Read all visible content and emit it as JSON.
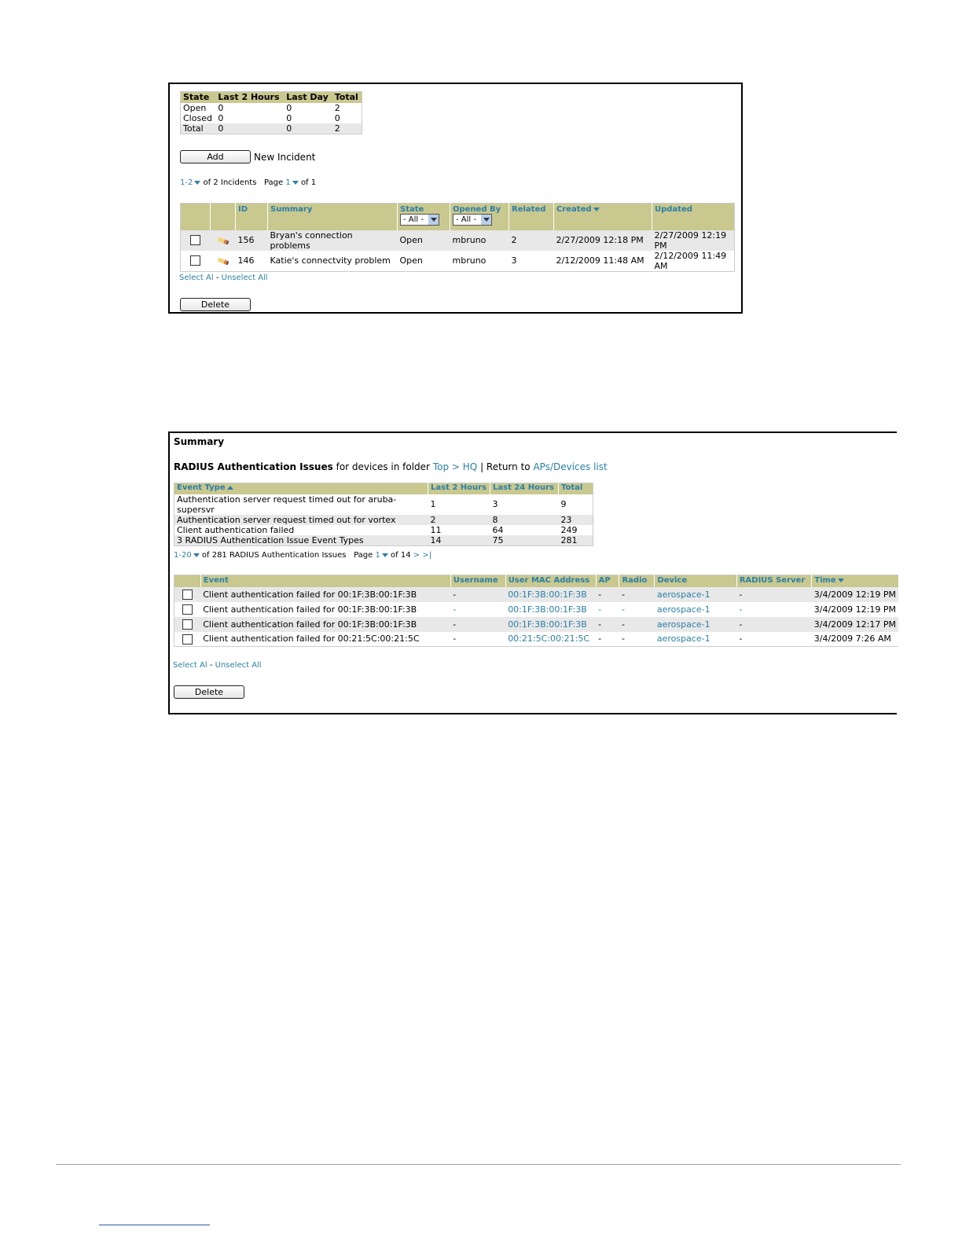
{
  "incidents": {
    "stats": {
      "headers": [
        "State",
        "Last 2 Hours",
        "Last Day",
        "Total"
      ],
      "rows": [
        [
          "Open",
          "0",
          "0",
          "2"
        ],
        [
          "Closed",
          "0",
          "0",
          "0"
        ],
        [
          "Total",
          "0",
          "0",
          "2"
        ]
      ]
    },
    "add_button": "Add",
    "add_label": "New Incident",
    "pager": {
      "range": "1-2",
      "of_text": "of 2 Incidents",
      "page_label": "Page",
      "page": "1",
      "page_of": "of 1"
    },
    "table_headers": {
      "id": "ID",
      "summary": "Summary",
      "state": "State",
      "opened_by": "Opened By",
      "related": "Related",
      "created": "Created",
      "updated": "Updated"
    },
    "state_filter": "- All -",
    "opened_by_filter": "- All -",
    "rows": [
      {
        "id": "156",
        "summary": "Bryan's connection problems",
        "state": "Open",
        "opened_by": "mbruno",
        "related": "2",
        "created": "2/27/2009 12:18 PM",
        "updated": "2/27/2009 12:19 PM"
      },
      {
        "id": "146",
        "summary": "Katie's connectvity problem",
        "state": "Open",
        "opened_by": "mbruno",
        "related": "3",
        "created": "2/12/2009 11:48 AM",
        "updated": "2/12/2009 11:49 AM"
      }
    ],
    "select_all": "Select Al",
    "separator": "-",
    "unselect_all": "Unselect All",
    "delete_button": "Delete"
  },
  "radius": {
    "summary_title": "Summary",
    "heading_bold": "RADIUS Authentication Issues",
    "heading_text": "for devices in folder",
    "folder_top": "Top",
    "folder_sep": ">",
    "folder_hq": "HQ",
    "return_text": "| Return to",
    "return_link": "APs/Devices list",
    "stats": {
      "headers": [
        "Event Type",
        "Last 2 Hours",
        "Last 24 Hours",
        "Total"
      ],
      "rows": [
        [
          "Authentication server request timed out for aruba-supersvr",
          "1",
          "3",
          "9"
        ],
        [
          "Authentication server request timed out for vortex",
          "2",
          "8",
          "23"
        ],
        [
          "Client authentication failed",
          "11",
          "64",
          "249"
        ],
        [
          "3 RADIUS Authentication Issue Event Types",
          "14",
          "75",
          "281"
        ]
      ]
    },
    "pager": {
      "range": "1-20",
      "of_text": "of 281 RADIUS Authentication Issues",
      "page_label": "Page",
      "page": "1",
      "page_of": "of 14",
      "next": ">",
      "last": ">|"
    },
    "table_headers": {
      "event": "Event",
      "username": "Username",
      "mac": "User MAC Address",
      "ap": "AP",
      "radio": "Radio",
      "device": "Device",
      "radius_server": "RADIUS Server",
      "time": "Time"
    },
    "rows": [
      {
        "event": "Client authentication failed for 00:1F:3B:00:1F:3B",
        "username": "-",
        "mac": "00:1F:3B:00:1F:3B",
        "ap": "-",
        "radio": "-",
        "device": "aerospace-1",
        "radius_server": "-",
        "time": "3/4/2009 12:19 PM"
      },
      {
        "event": "Client authentication failed for 00:1F:3B:00:1F:3B",
        "username": "-",
        "mac": "00:1F:3B:00:1F:3B",
        "ap": "-",
        "radio": "-",
        "device": "aerospace-1",
        "radius_server": "-",
        "time": "3/4/2009 12:19 PM"
      },
      {
        "event": "Client authentication failed for 00:1F:3B:00:1F:3B",
        "username": "-",
        "mac": "00:1F:3B:00:1F:3B",
        "ap": "-",
        "radio": "-",
        "device": "aerospace-1",
        "radius_server": "-",
        "time": "3/4/2009 12:17 PM"
      },
      {
        "event": "Client authentication failed for 00:21:5C:00:21:5C",
        "username": "-",
        "mac": "00:21:5C:00:21:5C",
        "ap": "-",
        "radio": "-",
        "device": "aerospace-1",
        "radius_server": "-",
        "time": "3/4/2009 7:26 AM"
      }
    ],
    "select_all": "Select Al",
    "separator": "-",
    "unselect_all": "Unselect All",
    "delete_button": "Delete"
  }
}
